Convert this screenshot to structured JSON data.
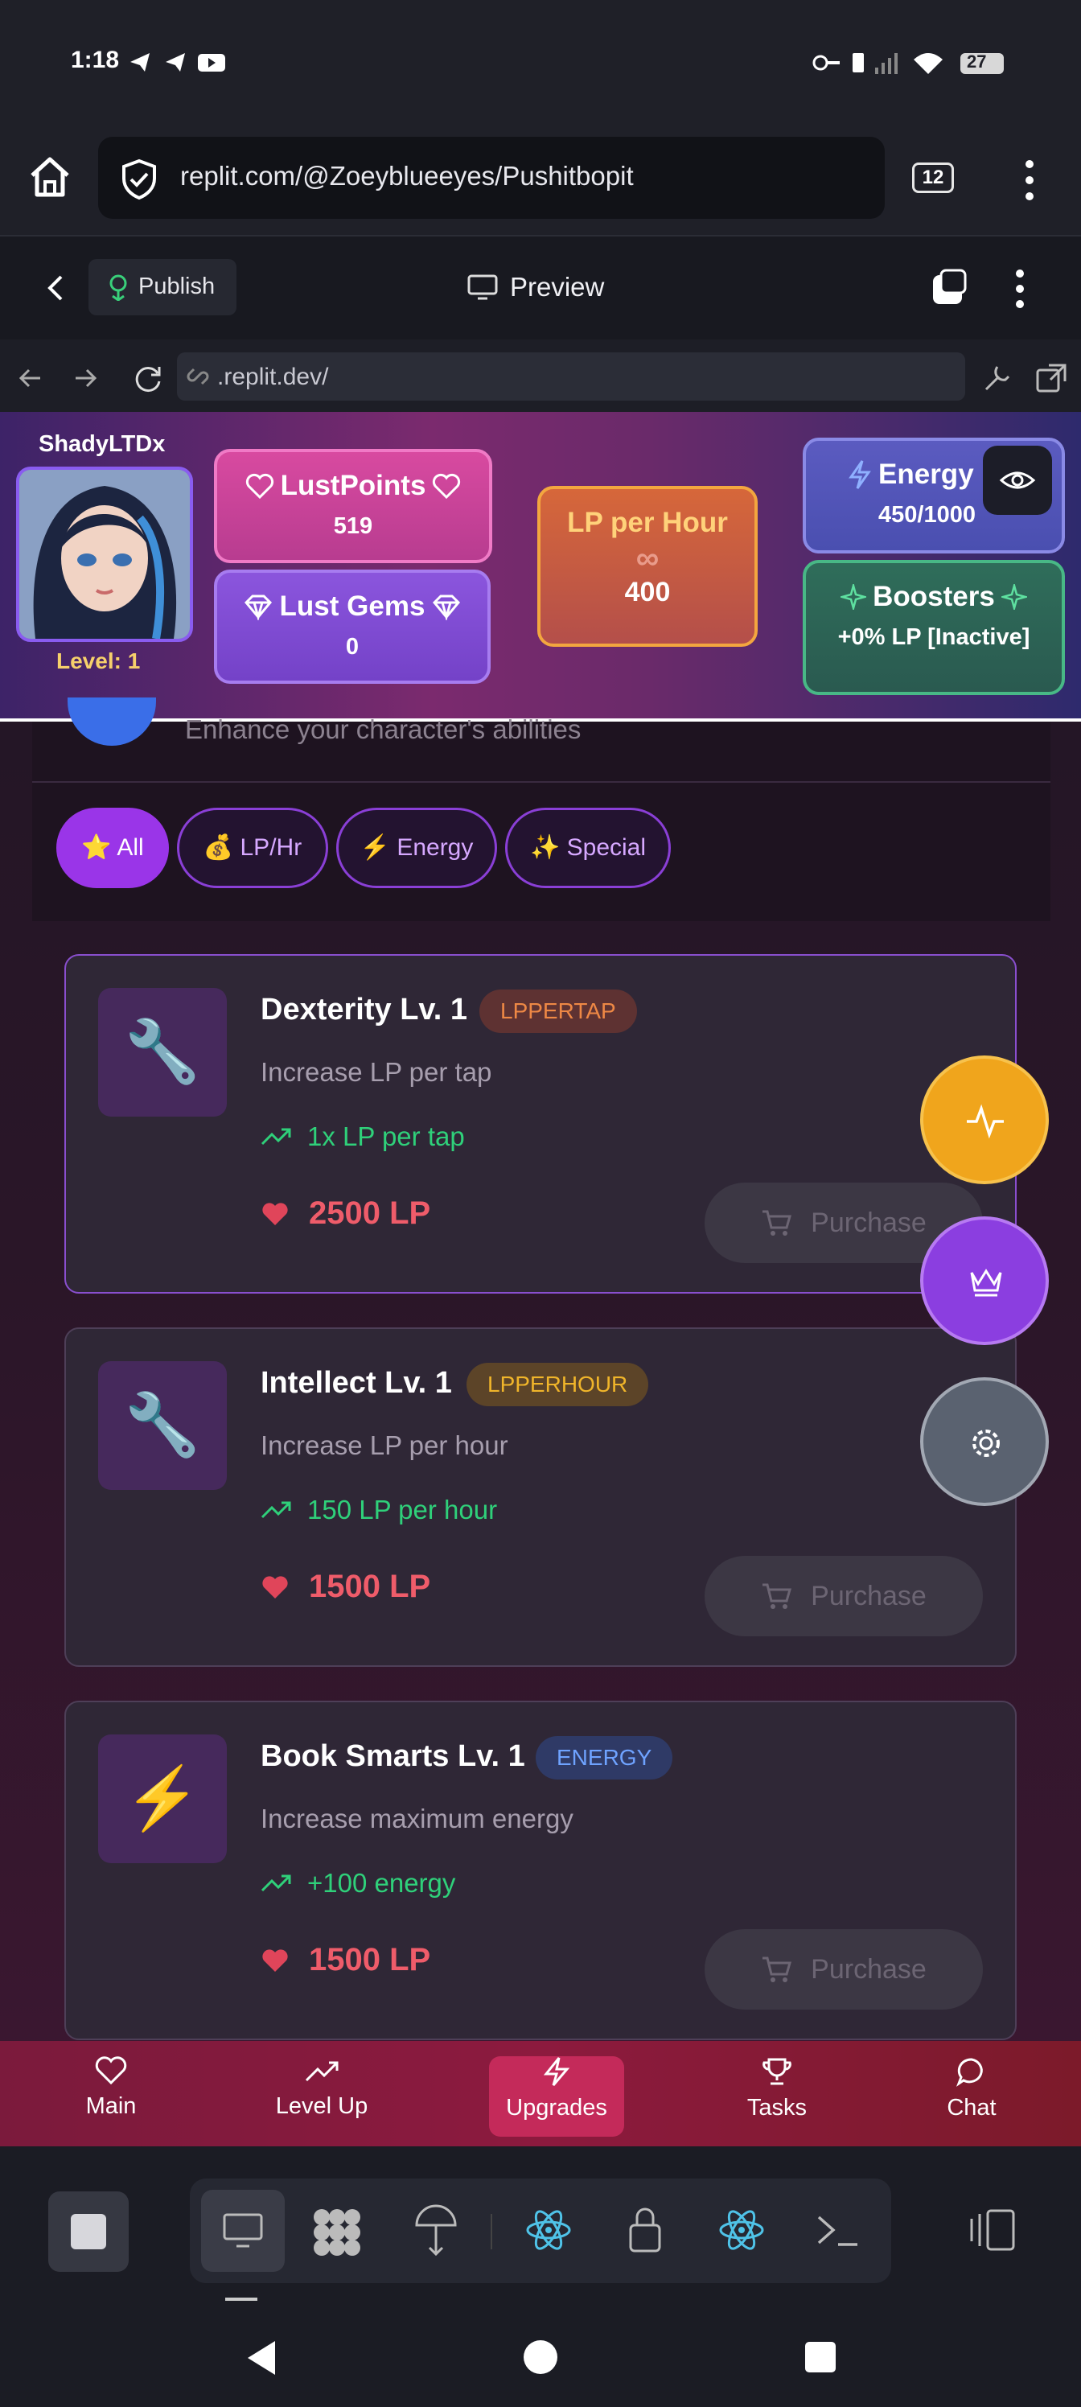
{
  "status_bar": {
    "time": "1:18",
    "battery": "27"
  },
  "browser": {
    "url": "replit.com/@Zoeyblueeyes/Pushitbopit",
    "tab_count": "12"
  },
  "replit_bar": {
    "publish_label": "Publish",
    "preview_label": "Preview"
  },
  "dev_bar": {
    "address": ".replit.dev/"
  },
  "player": {
    "name": "ShadyLTDx",
    "level_text": "Level: 1"
  },
  "stats": {
    "lust_points_label": "LustPoints",
    "lust_points_value": "519",
    "lust_gems_label": "Lust Gems",
    "lust_gems_value": "0",
    "lp_per_hour_label": "LP per Hour",
    "lp_per_hour_symbol": "∞",
    "lp_per_hour_value": "400",
    "energy_label": "Energy",
    "energy_value": "450/1000",
    "boosters_label": "Boosters",
    "boosters_value": "+0% LP [Inactive]"
  },
  "section": {
    "subtitle": "Enhance your character's abilities"
  },
  "filters": [
    {
      "label": "⭐ All",
      "active": true
    },
    {
      "label": "💰 LP/Hr",
      "active": false
    },
    {
      "label": "⚡ Energy",
      "active": false
    },
    {
      "label": "✨ Special",
      "active": false
    }
  ],
  "upgrades": [
    {
      "icon": "wrench-icon",
      "glyph": "🔧",
      "title": "Dexterity Lv. 1",
      "badge": "LPPERTAP",
      "badge_color": "#e5823f",
      "description": "Increase LP per tap",
      "effect": "1x LP per tap",
      "cost": "2500 LP",
      "button": "Purchase"
    },
    {
      "icon": "wrench-icon",
      "glyph": "🔧",
      "title": "Intellect Lv. 1",
      "badge": "LPPERHOUR",
      "badge_color": "#e8b23a",
      "description": "Increase LP per hour",
      "effect": "150 LP per hour",
      "cost": "1500 LP",
      "button": "Purchase"
    },
    {
      "icon": "lightning-icon",
      "glyph": "⚡",
      "title": "Book Smarts Lv. 1",
      "badge": "ENERGY",
      "badge_color": "#6fa3ff",
      "description": "Increase maximum energy",
      "effect": "+100 energy",
      "cost": "1500 LP",
      "button": "Purchase"
    }
  ],
  "bottom_nav": [
    {
      "label": "Main",
      "icon": "heart-icon"
    },
    {
      "label": "Level Up",
      "icon": "trending-up-icon"
    },
    {
      "label": "Upgrades",
      "icon": "lightning-icon",
      "active": true
    },
    {
      "label": "Tasks",
      "icon": "trophy-icon"
    },
    {
      "label": "Chat",
      "icon": "chat-bubble-icon"
    }
  ],
  "colors": {
    "accent": "#9a35e8",
    "positive": "#2fd07a",
    "cost": "#ef5c6a"
  }
}
